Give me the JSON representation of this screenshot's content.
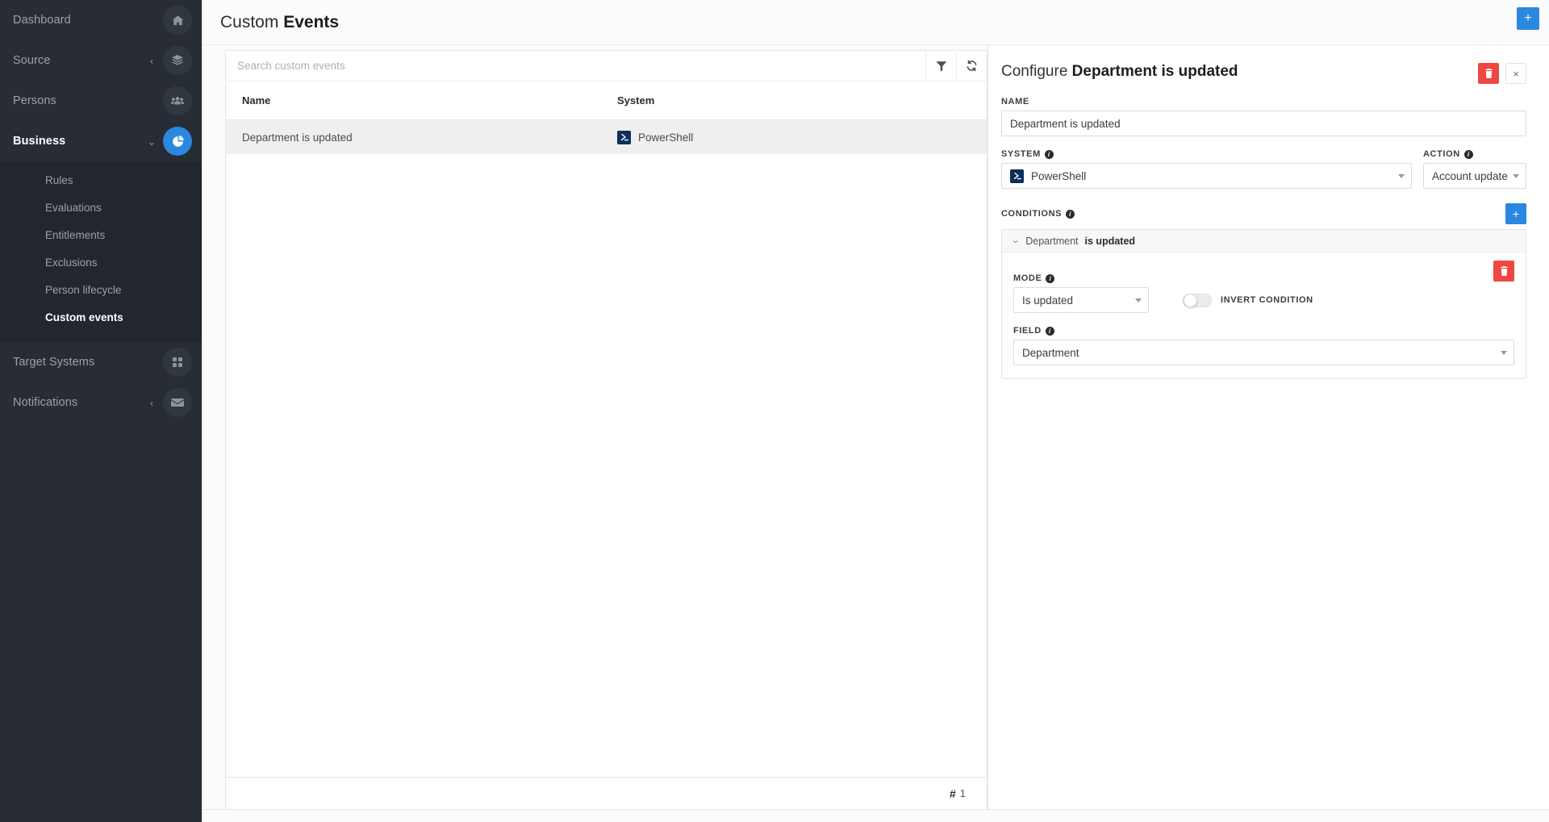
{
  "sidebar": {
    "items": [
      {
        "label": "Dashboard",
        "icon": "home-icon",
        "active": false,
        "caret": "",
        "key": "dashboard"
      },
      {
        "label": "Source",
        "icon": "layers-icon",
        "active": false,
        "caret": "‹",
        "key": "source"
      },
      {
        "label": "Persons",
        "icon": "users-icon",
        "active": false,
        "caret": "",
        "key": "persons"
      },
      {
        "label": "Business",
        "icon": "business-icon",
        "active": true,
        "caret": "⌄",
        "key": "business"
      }
    ],
    "subitems": [
      {
        "label": "Rules",
        "active": false
      },
      {
        "label": "Evaluations",
        "active": false
      },
      {
        "label": "Entitlements",
        "active": false
      },
      {
        "label": "Exclusions",
        "active": false
      },
      {
        "label": "Person lifecycle",
        "active": false
      },
      {
        "label": "Custom events",
        "active": true
      }
    ],
    "bottom_items": [
      {
        "label": "Target Systems",
        "icon": "grid-icon",
        "caret": ""
      },
      {
        "label": "Notifications",
        "icon": "envelope-icon",
        "caret": "‹"
      }
    ]
  },
  "topbar": {
    "title_light": "Custom",
    "title_bold": "Events",
    "add_button_label": "+"
  },
  "list": {
    "search_placeholder": "Search custom events",
    "search_value": "",
    "filter_icon": "filter-icon",
    "refresh_icon": "refresh-icon",
    "columns": [
      "Name",
      "System"
    ],
    "rows": [
      {
        "name": "Department is updated",
        "system": "PowerShell",
        "system_icon": "powershell-icon"
      }
    ],
    "footer_hash": "#",
    "footer_count": "1"
  },
  "config": {
    "title_light": "Configure",
    "title_bold": "Department is updated",
    "delete_label": "",
    "close_label": "×",
    "name_label": "NAME",
    "name_value": "Department is updated",
    "system_label": "SYSTEM",
    "system_value": "PowerShell",
    "action_label": "ACTION",
    "action_value": "Account update",
    "conditions_label": "CONDITIONS",
    "add_condition_label": "+",
    "condition": {
      "header_field": "Department",
      "header_mode": "is updated",
      "mode_label": "MODE",
      "mode_value": "Is updated",
      "invert_label": "INVERT CONDITION",
      "invert_on": false,
      "field_label": "FIELD",
      "field_value": "Department"
    }
  },
  "colors": {
    "accent": "#2a88e0",
    "danger": "#ef4741",
    "sidebar_bg": "#272c35",
    "subnav_bg": "#22262e"
  }
}
